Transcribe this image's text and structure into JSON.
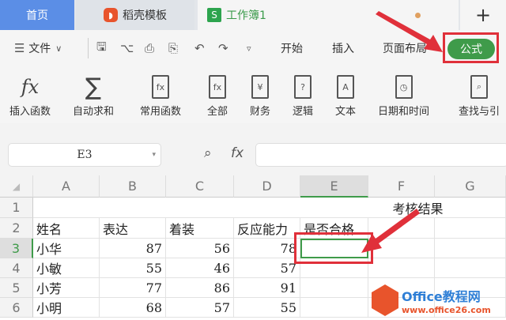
{
  "tabs": {
    "home": "首页",
    "template": "稻壳模板",
    "workbook": "工作簿1",
    "add": "+"
  },
  "toolbar": {
    "menu": "文件",
    "tabs": [
      "开始",
      "插入",
      "页面布局",
      "公式"
    ]
  },
  "ribbon": [
    {
      "label": "插入函数",
      "icon": "fx-icon"
    },
    {
      "label": "自动求和",
      "icon": "sum-icon"
    },
    {
      "label": "常用函数",
      "icon": "favorite-function-icon"
    },
    {
      "label": "全部",
      "icon": "all-functions-icon"
    },
    {
      "label": "财务",
      "icon": "finance-icon"
    },
    {
      "label": "逻辑",
      "icon": "logic-icon"
    },
    {
      "label": "文本",
      "icon": "text-icon"
    },
    {
      "label": "日期和时间",
      "icon": "datetime-icon"
    },
    {
      "label": "查找与引",
      "icon": "lookup-icon"
    }
  ],
  "formula_bar": {
    "name_box": "E3",
    "fx": "fx",
    "value": ""
  },
  "sheet": {
    "columns": [
      "A",
      "B",
      "C",
      "D",
      "E",
      "F",
      "G"
    ],
    "rows": [
      "1",
      "2",
      "3",
      "4",
      "5",
      "6"
    ],
    "title": "考核结果",
    "headers": [
      "姓名",
      "表达",
      "着装",
      "反应能力",
      "是否合格"
    ],
    "data": [
      [
        "小华",
        "87",
        "56",
        "78"
      ],
      [
        "小敏",
        "55",
        "46",
        "57"
      ],
      [
        "小芳",
        "77",
        "86",
        "91"
      ],
      [
        "小明",
        "68",
        "57",
        "55"
      ]
    ],
    "selected": "E3"
  },
  "watermark": {
    "brand": "Office教程网",
    "url": "www.office26.com"
  },
  "colors": {
    "accent": "#3f9b4a",
    "highlight": "#e0303a",
    "home_tab": "#5b8ee6"
  }
}
